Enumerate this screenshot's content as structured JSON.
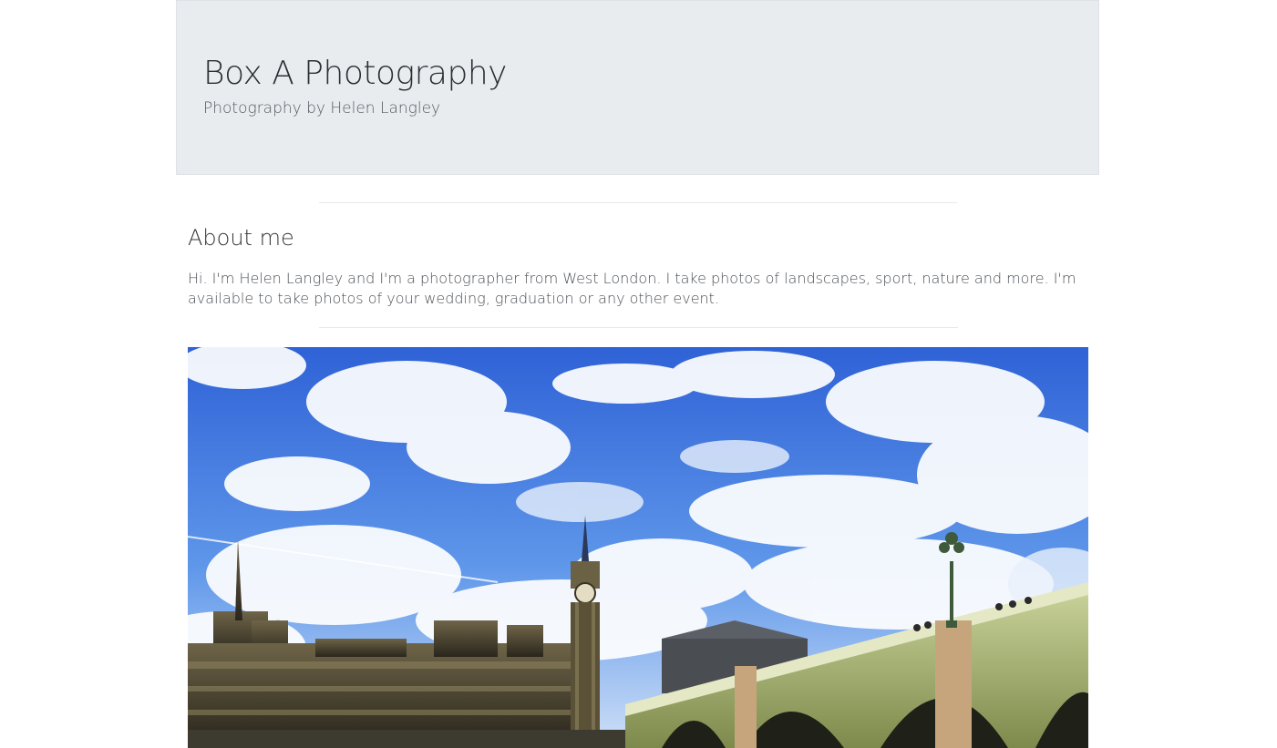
{
  "header": {
    "title": "Box A Photography",
    "subtitle": "Photography by Helen Langley",
    "background": "#e9ecef"
  },
  "about": {
    "heading": "About me",
    "text": "Hi. I'm Helen Langley and I'm a photographer from West London. I take photos of landscapes, sport, nature and more. I'm available to take photos of your wedding, graduation or any other event."
  },
  "photo": {
    "subject": "westminster-bridge-and-big-ben",
    "sky_color": "#3f78e0"
  }
}
